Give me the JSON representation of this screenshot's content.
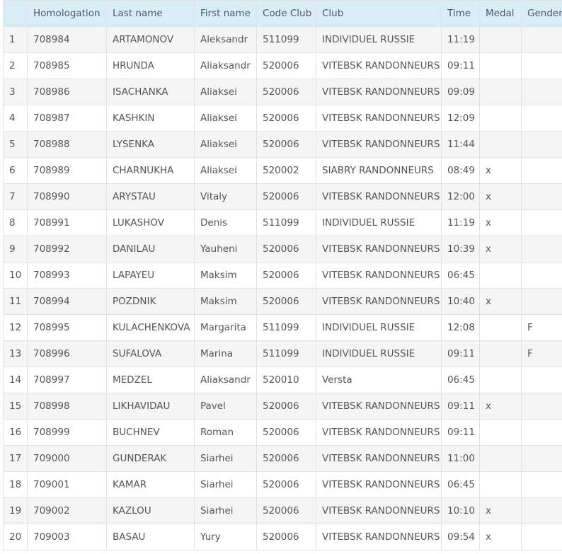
{
  "table": {
    "headers": [
      "",
      "Homologation",
      "Last name",
      "First name",
      "Code Club",
      "Club",
      "Time",
      "Medal",
      "Gender"
    ],
    "rows": [
      [
        "1",
        "708984",
        "ARTAMONOV",
        "Aleksandr",
        "511099",
        "INDIVIDUEL RUSSIE",
        "11:19",
        "",
        ""
      ],
      [
        "2",
        "708985",
        "HRUNDA",
        "Aliaksandr",
        "520006",
        "VITEBSK RANDONNEURS",
        "09:11",
        "",
        ""
      ],
      [
        "3",
        "708986",
        "ISACHANKA",
        "Aliaksei",
        "520006",
        "VITEBSK RANDONNEURS",
        "09:09",
        "",
        ""
      ],
      [
        "4",
        "708987",
        "KASHKIN",
        "Aliaksei",
        "520006",
        "VITEBSK RANDONNEURS",
        "12:09",
        "",
        ""
      ],
      [
        "5",
        "708988",
        "LYSENKA",
        "Aliaksei",
        "520006",
        "VITEBSK RANDONNEURS",
        "11:44",
        "",
        ""
      ],
      [
        "6",
        "708989",
        "CHARNUKHA",
        "Aliaksei",
        "520002",
        "SIABRY RANDONNEURS",
        "08:49",
        "x",
        ""
      ],
      [
        "7",
        "708990",
        "ARYSTAU",
        "Vitaly",
        "520006",
        "VITEBSK RANDONNEURS",
        "12:00",
        "x",
        ""
      ],
      [
        "8",
        "708991",
        "LUKASHOV",
        "Denis",
        "511099",
        "INDIVIDUEL RUSSIE",
        "11:19",
        "x",
        ""
      ],
      [
        "9",
        "708992",
        "DANILAU",
        "Yauheni",
        "520006",
        "VITEBSK RANDONNEURS",
        "10:39",
        "x",
        ""
      ],
      [
        "10",
        "708993",
        "LAPAYEU",
        "Maksim",
        "520006",
        "VITEBSK RANDONNEURS",
        "06:45",
        "",
        ""
      ],
      [
        "11",
        "708994",
        "POZDNIK",
        "Maksim",
        "520006",
        "VITEBSK RANDONNEURS",
        "10:40",
        "x",
        ""
      ],
      [
        "12",
        "708995",
        "KULACHENKOVA",
        "Margarita",
        "511099",
        "INDIVIDUEL RUSSIE",
        "12:08",
        "",
        "F"
      ],
      [
        "13",
        "708996",
        "SUFALOVA",
        "Marina",
        "511099",
        "INDIVIDUEL RUSSIE",
        "09:11",
        "",
        "F"
      ],
      [
        "14",
        "708997",
        "MEDZEL",
        "Aliaksandr",
        "520010",
        "Versta",
        "06:45",
        "",
        ""
      ],
      [
        "15",
        "708998",
        "LIKHAVIDAU",
        "Pavel",
        "520006",
        "VITEBSK RANDONNEURS",
        "09:11",
        "x",
        ""
      ],
      [
        "16",
        "708999",
        "BUCHNEV",
        "Roman",
        "520006",
        "VITEBSK RANDONNEURS",
        "09:11",
        "",
        ""
      ],
      [
        "17",
        "709000",
        "GUNDERAK",
        "Siarhei",
        "520006",
        "VITEBSK RANDONNEURS",
        "11:00",
        "",
        ""
      ],
      [
        "18",
        "709001",
        "KAMAR",
        "Siarhei",
        "520006",
        "VITEBSK RANDONNEURS",
        "06:45",
        "",
        ""
      ],
      [
        "19",
        "709002",
        "KAZLOU",
        "Siarhei",
        "520006",
        "VITEBSK RANDONNEURS",
        "10:10",
        "x",
        ""
      ],
      [
        "20",
        "709003",
        "BASAU",
        "Yury",
        "520006",
        "VITEBSK RANDONNEURS",
        "09:54",
        "x",
        ""
      ]
    ]
  },
  "colors": {
    "header_bg": "#daedf7",
    "row_alt_bg": "#f5f5f5",
    "border": "#dfe3e6",
    "text": "#555555"
  }
}
